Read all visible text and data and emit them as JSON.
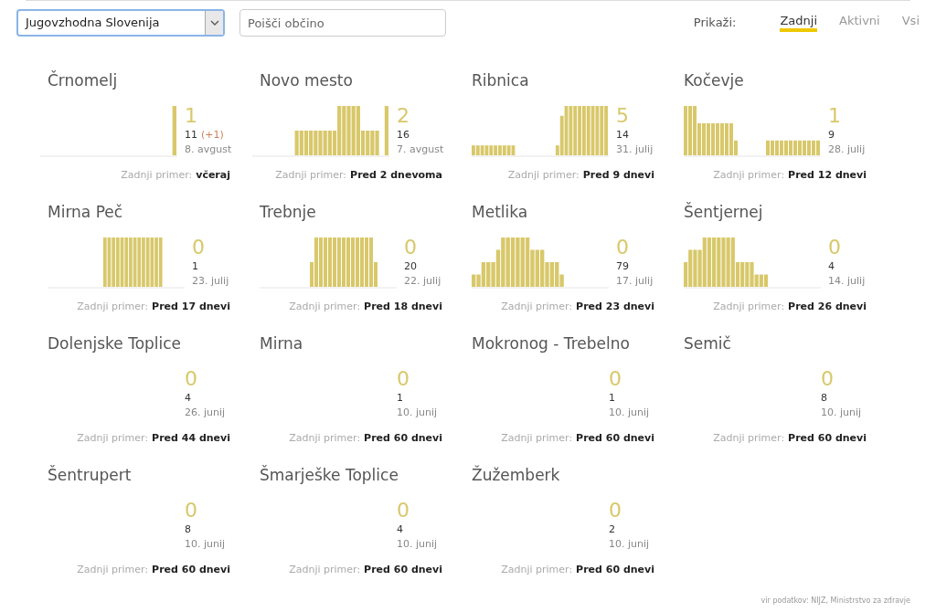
{
  "region_select": {
    "value": "Jugovzhodna Slovenija"
  },
  "search": {
    "placeholder": "Poišči občino"
  },
  "filter": {
    "label": "Prikaži:",
    "options": [
      {
        "label": "Zadnji",
        "selected": true
      },
      {
        "label": "Aktivni",
        "selected": false
      },
      {
        "label": "Vsi",
        "selected": false
      }
    ]
  },
  "cards": [
    {
      "name": "Črnomelj",
      "active": "1",
      "total": "11",
      "delta": "(+1)",
      "date": "8. avgust",
      "last_label": "Zadnji primer:",
      "last_value": "včeraj"
    },
    {
      "name": "Novo mesto",
      "active": "2",
      "total": "16",
      "date": "7. avgust",
      "last_label": "Zadnji primer:",
      "last_value": "Pred 2 dnevoma"
    },
    {
      "name": "Ribnica",
      "active": "5",
      "total": "14",
      "date": "31. julij",
      "last_label": "Zadnji primer:",
      "last_value": "Pred 9 dnevi"
    },
    {
      "name": "Kočevje",
      "active": "1",
      "total": "9",
      "date": "28. julij",
      "last_label": "Zadnji primer:",
      "last_value": "Pred 12 dnevi"
    },
    {
      "name": "Mirna Peč",
      "active": "0",
      "total": "1",
      "date": "23. julij",
      "last_label": "Zadnji primer:",
      "last_value": "Pred 17 dnevi"
    },
    {
      "name": "Trebnje",
      "active": "0",
      "total": "20",
      "date": "22. julij",
      "last_label": "Zadnji primer:",
      "last_value": "Pred 18 dnevi"
    },
    {
      "name": "Metlika",
      "active": "0",
      "total": "79",
      "date": "17. julij",
      "last_label": "Zadnji primer:",
      "last_value": "Pred 23 dnevi"
    },
    {
      "name": "Šentjernej",
      "active": "0",
      "total": "4",
      "date": "14. julij",
      "last_label": "Zadnji primer:",
      "last_value": "Pred 26 dnevi"
    },
    {
      "name": "Dolenjske Toplice",
      "active": "0",
      "total": "4",
      "date": "26. junij",
      "last_label": "Zadnji primer:",
      "last_value": "Pred 44 dnevi"
    },
    {
      "name": "Mirna",
      "active": "0",
      "total": "1",
      "date": "10. junij",
      "last_label": "Zadnji primer:",
      "last_value": "Pred 60 dnevi"
    },
    {
      "name": "Mokronog - Trebelno",
      "active": "0",
      "total": "1",
      "date": "10. junij",
      "last_label": "Zadnji primer:",
      "last_value": "Pred 60 dnevi"
    },
    {
      "name": "Semič",
      "active": "0",
      "total": "8",
      "date": "10. junij",
      "last_label": "Zadnji primer:",
      "last_value": "Pred 60 dnevi"
    },
    {
      "name": "Šentrupert",
      "active": "0",
      "total": "8",
      "date": "10. junij",
      "last_label": "Zadnji primer:",
      "last_value": "Pred 60 dnevi"
    },
    {
      "name": "Šmarješke Toplice",
      "active": "0",
      "total": "4",
      "date": "10. junij",
      "last_label": "Zadnji primer:",
      "last_value": "Pred 60 dnevi"
    },
    {
      "name": "Žužemberk",
      "active": "0",
      "total": "2",
      "date": "10. junij",
      "last_label": "Zadnji primer:",
      "last_value": "Pred 60 dnevi"
    }
  ],
  "source": "vir podatkov: NIJZ, Ministrstvo za zdravje"
}
